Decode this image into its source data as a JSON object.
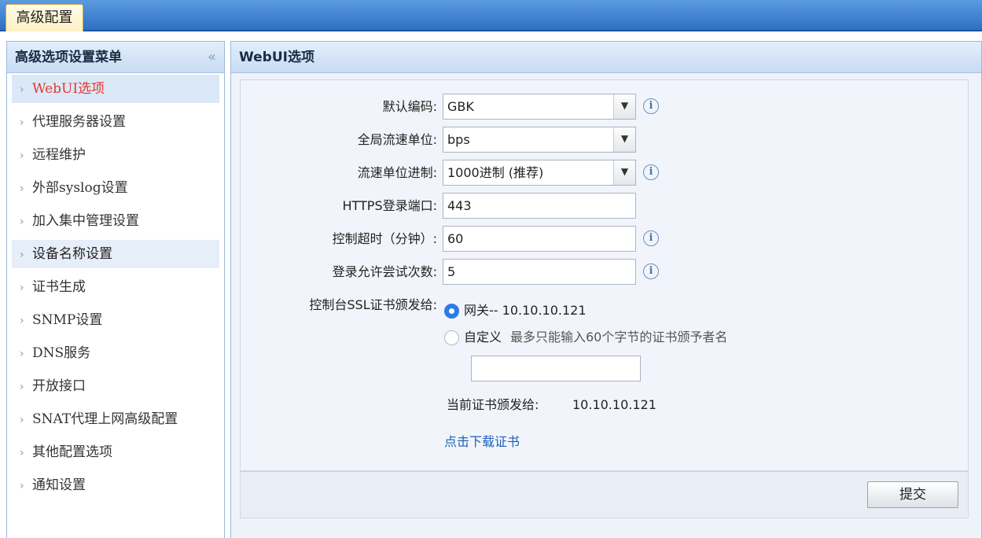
{
  "top_tab": "高级配置",
  "sidebar": {
    "title": "高级选项设置菜单",
    "collapse_glyph": "«",
    "items": [
      {
        "label": "WebUI选项"
      },
      {
        "label": "代理服务器设置"
      },
      {
        "label": "远程维护"
      },
      {
        "label": "外部syslog设置"
      },
      {
        "label": "加入集中管理设置"
      },
      {
        "label": "设备名称设置"
      },
      {
        "label": "证书生成"
      },
      {
        "label": "SNMP设置"
      },
      {
        "label": "DNS服务"
      },
      {
        "label": "开放接口"
      },
      {
        "label": "SNAT代理上网高级配置"
      },
      {
        "label": "其他配置选项"
      },
      {
        "label": "通知设置"
      }
    ]
  },
  "panel": {
    "title": "WebUI选项",
    "fields": {
      "encoding_label": "默认编码:",
      "encoding_value": "GBK",
      "rate_unit_label": "全局流速单位:",
      "rate_unit_value": "bps",
      "rate_base_label": "流速单位进制:",
      "rate_base_value": "1000进制 (推荐)",
      "https_port_label": "HTTPS登录端口:",
      "https_port_value": "443",
      "timeout_label": "控制超时（分钟）:",
      "timeout_value": "60",
      "login_attempts_label": "登录允许尝试次数:",
      "login_attempts_value": "5",
      "ssl_label": "控制台SSL证书颁发给:",
      "ssl_option_gateway": "网关-- 10.10.10.121",
      "ssl_option_custom": "自定义",
      "ssl_custom_hint": "最多只能输入60个字节的证书颁予者名",
      "ssl_custom_value": "",
      "current_cert_label": "当前证书颁发给:",
      "current_cert_value": "10.10.10.121",
      "download_link": "点击下载证书"
    },
    "submit_label": "提交"
  },
  "icons": {
    "info": "i",
    "dropdown": "▼",
    "menu_arrow": "›"
  }
}
